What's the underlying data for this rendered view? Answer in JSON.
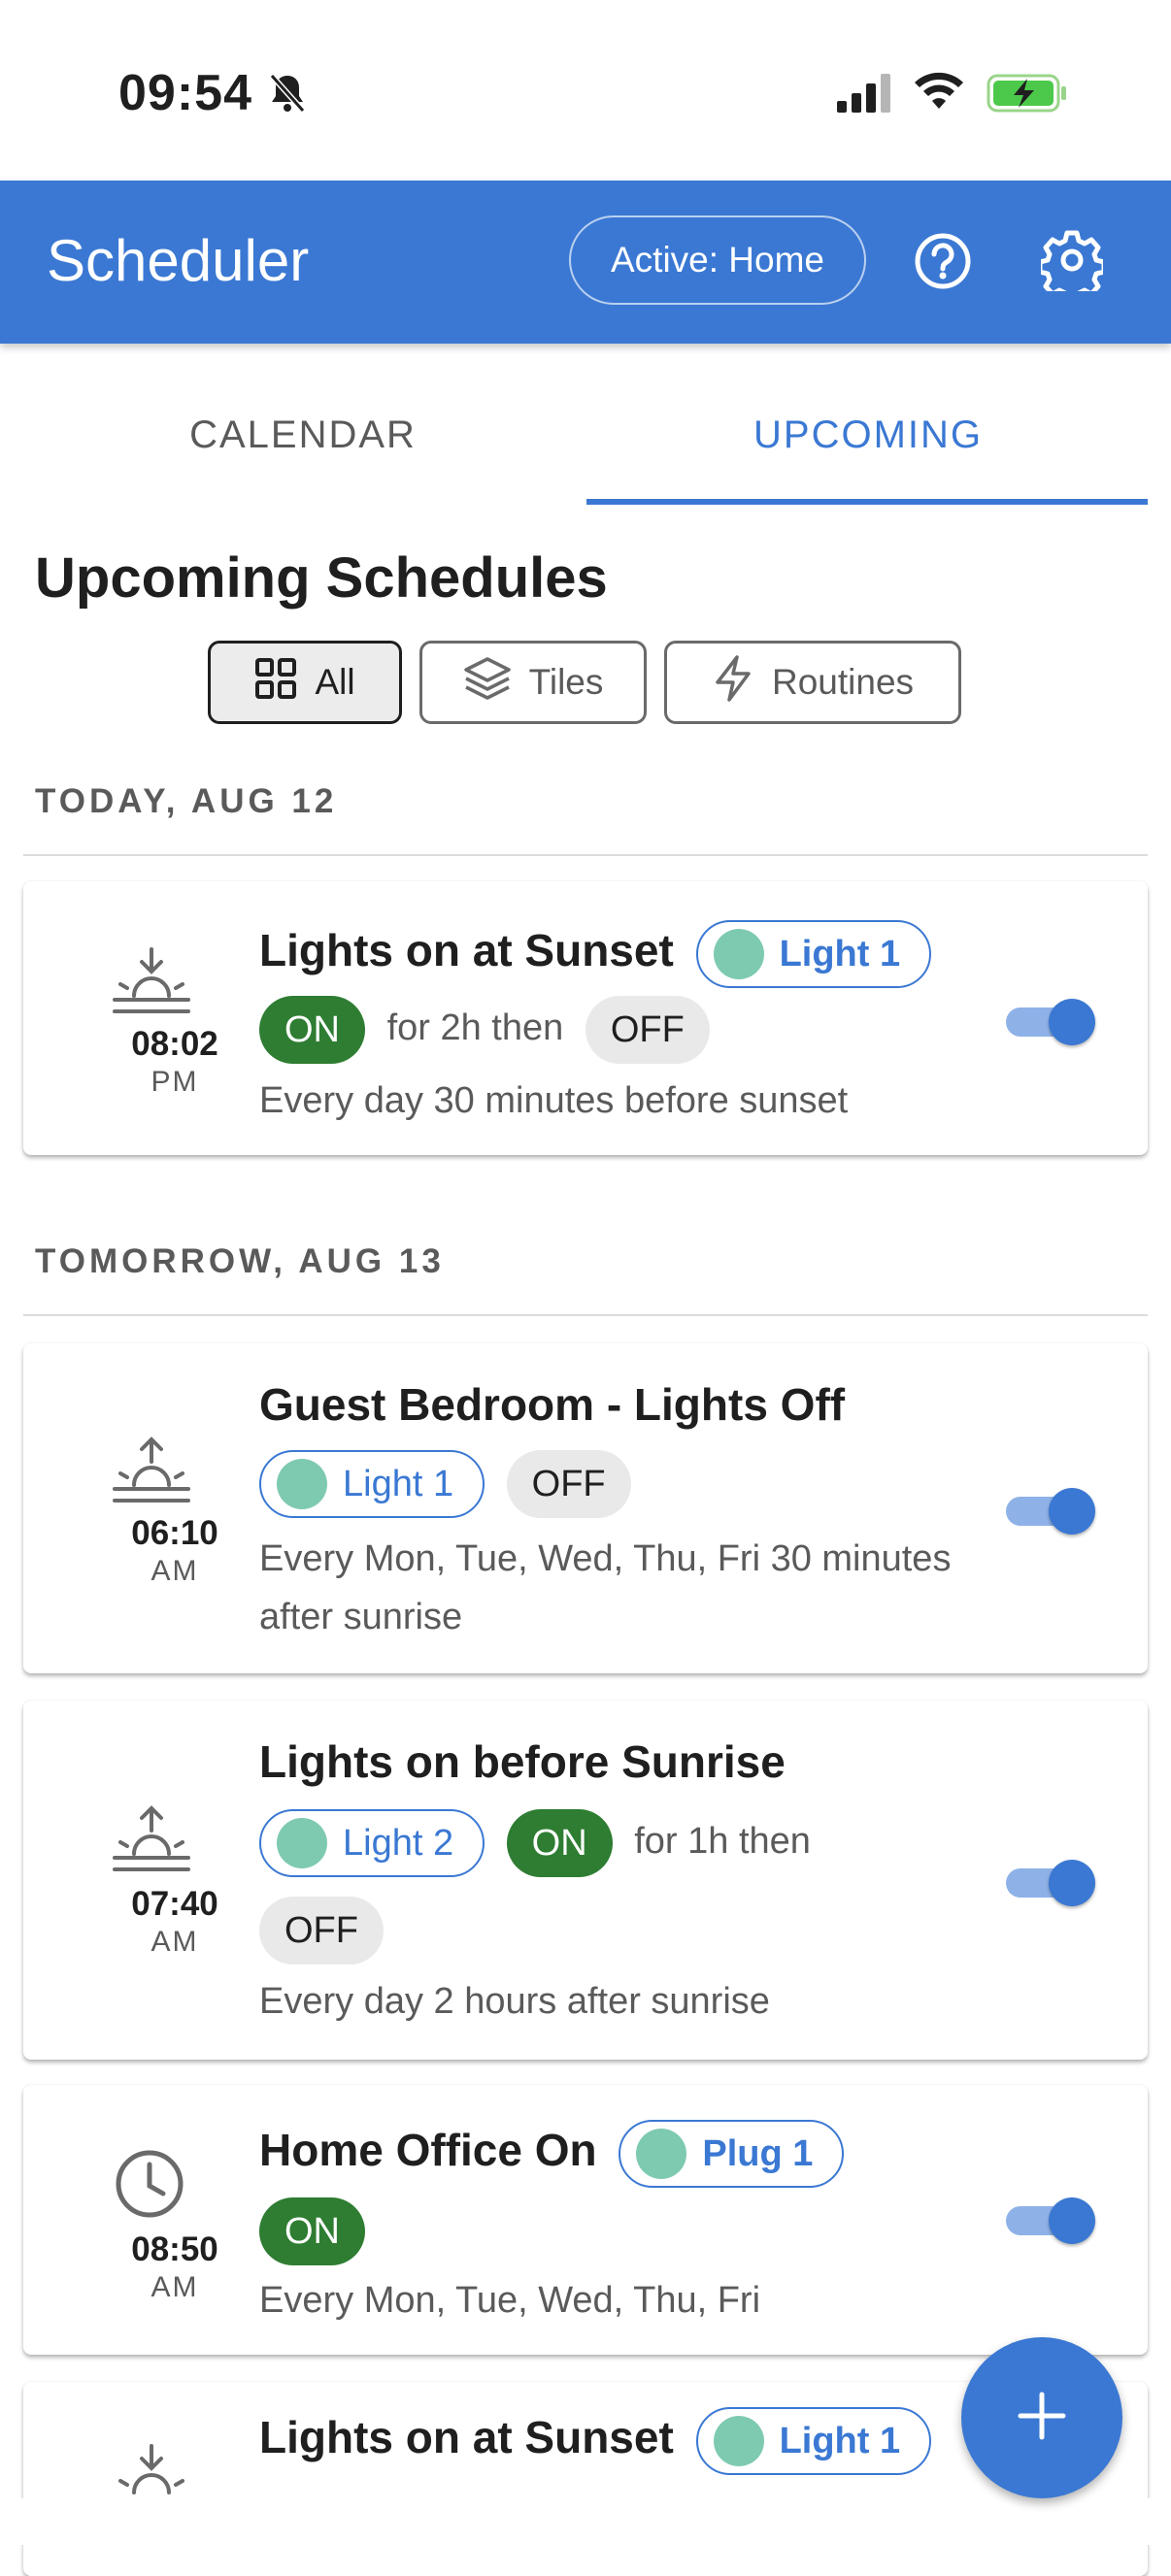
{
  "status_bar": {
    "time": "09:54"
  },
  "app_bar": {
    "title": "Scheduler",
    "active_label": "Active: Home"
  },
  "tabs": [
    {
      "label": "CALENDAR"
    },
    {
      "label": "UPCOMING"
    }
  ],
  "page": {
    "heading": "Upcoming Schedules"
  },
  "filters": [
    {
      "label": "All"
    },
    {
      "label": "Tiles"
    },
    {
      "label": "Routines"
    }
  ],
  "sections": [
    {
      "label": "TODAY, AUG 12"
    },
    {
      "label": "TOMORROW, AUG 13"
    }
  ],
  "schedules": [
    {
      "name": "Lights on at Sunset",
      "device": "Light 1",
      "time": "08:02",
      "ampm": "PM",
      "on": "ON",
      "mid": "for 2h then",
      "off": "OFF",
      "desc": "Every day 30 minutes before sunset",
      "icon": "sunset-icon",
      "enabled": true
    },
    {
      "name": "Guest Bedroom - Lights Off",
      "device": "Light 1",
      "time": "06:10",
      "ampm": "AM",
      "off": "OFF",
      "desc": "Every Mon, Tue, Wed, Thu, Fri 30 minutes after sunrise",
      "icon": "sunrise-icon",
      "enabled": true
    },
    {
      "name": "Lights on before Sunrise",
      "device": "Light 2",
      "time": "07:40",
      "ampm": "AM",
      "on": "ON",
      "mid": "for 1h then",
      "off": "OFF",
      "desc": "Every day 2 hours after sunrise",
      "icon": "sunrise-icon",
      "enabled": true
    },
    {
      "name": "Home Office On",
      "device": "Plug 1",
      "time": "08:50",
      "ampm": "AM",
      "on": "ON",
      "desc": "Every Mon, Tue, Wed, Thu, Fri",
      "icon": "clock-icon",
      "enabled": true
    },
    {
      "name": "Lights on at Sunset",
      "device": "Light 1",
      "icon": "sunset-icon"
    }
  ],
  "colors": {
    "primary": "#3a78d3",
    "on_chip": "#2e7d32",
    "device_dot": "#7ecab0"
  }
}
